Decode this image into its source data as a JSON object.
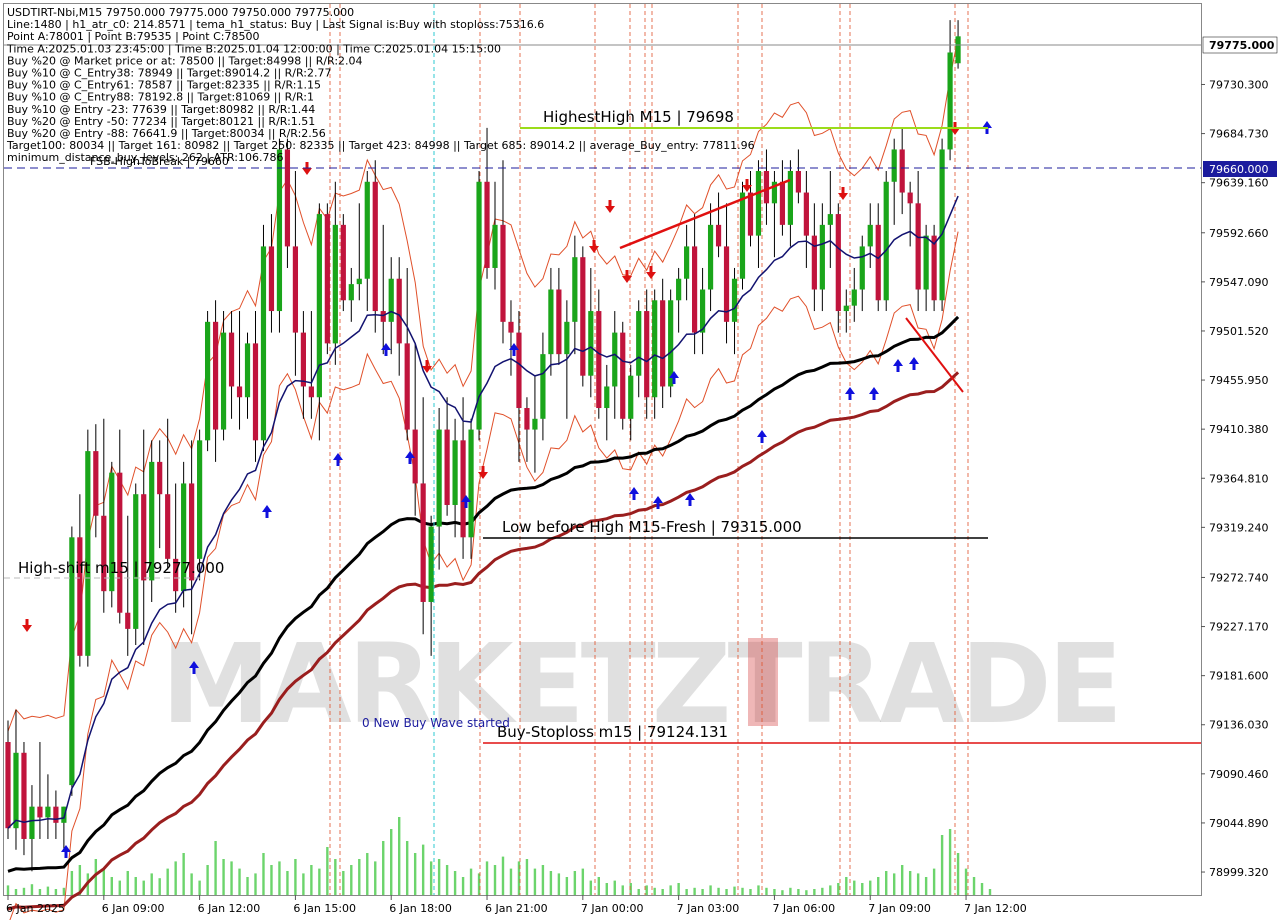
{
  "info_lines": [
    "USDTIRT-Nbi,M15  79750.000 79775.000 79750.000 79775.000",
    "Line:1480 | h1_atr_c0: 214.8571 | tema_h1_status: Buy | Last Signal is:Buy with stoploss:75316.6",
    "Point A:78001 | Point B:79535 | Point C:78500",
    "Time A:2025.01.03 23:45:00 | Time B:2025.01.04 12:00:00 | Time C:2025.01.04 15:15:00",
    "Buy %20 @ Market price or at: 78500 || Target:84998 || R/R:2.04",
    "Buy %10 @ C_Entry38: 78949 || Target:89014.2 || R/R:2.77",
    "Buy %10 @ C_Entry61: 78587 || Target:82335 || R/R:1.15",
    "Buy %10 @ C_Entry88: 78192.8 || Target:81069 || R/R:1",
    "Buy %10 @ Entry -23: 77639 || Target:80982 || R/R:1.44",
    "Buy %20 @ Entry -50: 77234 || Target:80121 || R/R:1.51",
    "Buy %20 @ Entry -88: 76641.9 || Target:80034 || R/R:2.56",
    "Target100: 80034 || Target 161: 80982 || Target 250: 82335 || Target 423: 84998 || Target 685: 89014.2 || average_Buy_entry: 77811.96",
    "minimum_distance_buy_levels: 262 | ATR:106.786"
  ],
  "watermark": "MARKETZTRADE",
  "annotations": {
    "highest_high": "HighestHigh   M15 | 79698",
    "low_before_high": "Low before High   M15-Fresh | 79315.000",
    "high_shift": "High-shift m15 | 79277.000",
    "buy_stoploss": "Buy-Stoploss m15 | 79124.131",
    "fsb_high_tobreak": "FSB-HighToBreak | 79660",
    "new_buy_wave": "0 New Buy Wave started"
  },
  "price_tags": {
    "current": "79775.000",
    "level": "79660.000"
  },
  "colors": {
    "bull_candle": "#1aa51a",
    "bear_candle": "#c0143c",
    "stoploss_line": "#e01010",
    "highest_high_line": "#9bdc1a",
    "fsb_line": "#1c1c9e",
    "tema_line": "#121270",
    "ma_black": "#000000",
    "ma_brown": "#9a1e1e",
    "envelope": "#e0502a",
    "volume": "#6cd46c",
    "arrow_up": "#1010dd",
    "arrow_down": "#dd1010",
    "price_tag_bg": "#1c1c9e"
  },
  "chart_data": {
    "type": "candlestick",
    "symbol": "USDTIRT-Nbi",
    "timeframe": "M15",
    "y_ticks": [
      "79730.300",
      "79684.730",
      "79639.160",
      "79592.660",
      "79547.090",
      "79501.520",
      "79455.950",
      "79410.380",
      "79364.810",
      "79319.240",
      "79272.740",
      "79227.170",
      "79181.600",
      "79136.030",
      "79090.460",
      "79044.890",
      "78999.320"
    ],
    "y_tick_values": [
      79730.3,
      79684.73,
      79639.16,
      79592.66,
      79547.09,
      79501.52,
      79455.95,
      79410.38,
      79364.81,
      79319.24,
      79272.74,
      79227.17,
      79181.6,
      79136.03,
      79090.46,
      79044.89,
      78999.32
    ],
    "ylim": [
      78978,
      79805
    ],
    "x_ticks": [
      "6 Jan 2025",
      "6 Jan 09:00",
      "6 Jan 12:00",
      "6 Jan 15:00",
      "6 Jan 18:00",
      "6 Jan 21:00",
      "7 Jan 00:00",
      "7 Jan 03:00",
      "7 Jan 06:00",
      "7 Jan 09:00",
      "7 Jan 12:00"
    ],
    "x_tick_bars": [
      0,
      12,
      24,
      36,
      48,
      60,
      72,
      84,
      96,
      108,
      120
    ],
    "bars_total": 124,
    "candles": [
      [
        79120,
        79140,
        79030,
        79040
      ],
      [
        79040,
        79150,
        79020,
        79110
      ],
      [
        79110,
        79120,
        79015,
        79030
      ],
      [
        79030,
        79080,
        79000,
        79060
      ],
      [
        79060,
        79120,
        79030,
        79050
      ],
      [
        79050,
        79090,
        79030,
        79060
      ],
      [
        79060,
        79075,
        79030,
        79045
      ],
      [
        79045,
        79060,
        79020,
        79060
      ],
      [
        79080,
        79320,
        79070,
        79310
      ],
      [
        79310,
        79350,
        79190,
        79200
      ],
      [
        79200,
        79410,
        79190,
        79390
      ],
      [
        79390,
        79415,
        79310,
        79330
      ],
      [
        79330,
        79420,
        79240,
        79260
      ],
      [
        79260,
        79380,
        79245,
        79370
      ],
      [
        79370,
        79410,
        79230,
        79240
      ],
      [
        79240,
        79330,
        79200,
        79225
      ],
      [
        79225,
        79360,
        79210,
        79350
      ],
      [
        79350,
        79410,
        79210,
        79270
      ],
      [
        79270,
        79400,
        79250,
        79380
      ],
      [
        79380,
        79400,
        79300,
        79350
      ],
      [
        79350,
        79420,
        79280,
        79290
      ],
      [
        79290,
        79360,
        79240,
        79260
      ],
      [
        79260,
        79380,
        79245,
        79360
      ],
      [
        79360,
        79400,
        79220,
        79270
      ],
      [
        79290,
        79410,
        79270,
        79400
      ],
      [
        79400,
        79520,
        79390,
        79510
      ],
      [
        79510,
        79530,
        79380,
        79410
      ],
      [
        79410,
        79520,
        79400,
        79500
      ],
      [
        79500,
        79520,
        79420,
        79450
      ],
      [
        79450,
        79520,
        79410,
        79440
      ],
      [
        79440,
        79500,
        79420,
        79490
      ],
      [
        79490,
        79520,
        79380,
        79400
      ],
      [
        79400,
        79600,
        79390,
        79580
      ],
      [
        79580,
        79610,
        79500,
        79520
      ],
      [
        79520,
        79680,
        79500,
        79670
      ],
      [
        79670,
        79680,
        79560,
        79580
      ],
      [
        79580,
        79650,
        79460,
        79500
      ],
      [
        79500,
        79520,
        79420,
        79450
      ],
      [
        79450,
        79520,
        79420,
        79440
      ],
      [
        79440,
        79620,
        79400,
        79610
      ],
      [
        79610,
        79620,
        79480,
        79490
      ],
      [
        79490,
        79640,
        79470,
        79600
      ],
      [
        79600,
        79610,
        79520,
        79530
      ],
      [
        79530,
        79560,
        79510,
        79545
      ],
      [
        79545,
        79620,
        79530,
        79550
      ],
      [
        79550,
        79650,
        79520,
        79640
      ],
      [
        79640,
        79660,
        79500,
        79520
      ],
      [
        79520,
        79600,
        79480,
        79510
      ],
      [
        79510,
        79570,
        79480,
        79550
      ],
      [
        79550,
        79570,
        79460,
        79490
      ],
      [
        79490,
        79560,
        79400,
        79410
      ],
      [
        79410,
        79490,
        79330,
        79360
      ],
      [
        79360,
        79440,
        79220,
        79250
      ],
      [
        79250,
        79330,
        79200,
        79320
      ],
      [
        79320,
        79430,
        79280,
        79410
      ],
      [
        79410,
        79440,
        79330,
        79340
      ],
      [
        79340,
        79420,
        79310,
        79400
      ],
      [
        79400,
        79440,
        79290,
        79310
      ],
      [
        79310,
        79420,
        79290,
        79410
      ],
      [
        79410,
        79650,
        79400,
        79640
      ],
      [
        79640,
        79690,
        79550,
        79560
      ],
      [
        79560,
        79640,
        79540,
        79600
      ],
      [
        79600,
        79660,
        79490,
        79510
      ],
      [
        79510,
        79530,
        79460,
        79500
      ],
      [
        79500,
        79520,
        79380,
        79430
      ],
      [
        79430,
        79440,
        79380,
        79410
      ],
      [
        79410,
        79460,
        79370,
        79420
      ],
      [
        79420,
        79500,
        79400,
        79480
      ],
      [
        79480,
        79560,
        79460,
        79540
      ],
      [
        79540,
        79560,
        79470,
        79480
      ],
      [
        79480,
        79530,
        79420,
        79510
      ],
      [
        79510,
        79590,
        79480,
        79570
      ],
      [
        79570,
        79580,
        79450,
        79460
      ],
      [
        79460,
        79560,
        79440,
        79520
      ],
      [
        79520,
        79540,
        79420,
        79430
      ],
      [
        79430,
        79470,
        79400,
        79450
      ],
      [
        79450,
        79520,
        79420,
        79500
      ],
      [
        79500,
        79510,
        79410,
        79420
      ],
      [
        79420,
        79470,
        79400,
        79460
      ],
      [
        79460,
        79530,
        79440,
        79520
      ],
      [
        79520,
        79540,
        79420,
        79440
      ],
      [
        79440,
        79540,
        79420,
        79530
      ],
      [
        79530,
        79550,
        79430,
        79450
      ],
      [
        79450,
        79540,
        79440,
        79530
      ],
      [
        79530,
        79560,
        79500,
        79550
      ],
      [
        79550,
        79600,
        79530,
        79580
      ],
      [
        79580,
        79610,
        79480,
        79500
      ],
      [
        79500,
        79560,
        79480,
        79540
      ],
      [
        79540,
        79620,
        79520,
        79600
      ],
      [
        79600,
        79630,
        79570,
        79580
      ],
      [
        79580,
        79620,
        79490,
        79510
      ],
      [
        79510,
        79560,
        79480,
        79550
      ],
      [
        79550,
        79640,
        79540,
        79630
      ],
      [
        79630,
        79650,
        79580,
        79590
      ],
      [
        79590,
        79660,
        79560,
        79650
      ],
      [
        79650,
        79670,
        79600,
        79620
      ],
      [
        79620,
        79650,
        79570,
        79640
      ],
      [
        79640,
        79660,
        79590,
        79600
      ],
      [
        79600,
        79660,
        79580,
        79650
      ],
      [
        79650,
        79670,
        79620,
        79630
      ],
      [
        79630,
        79650,
        79560,
        79590
      ],
      [
        79590,
        79620,
        79520,
        79540
      ],
      [
        79540,
        79620,
        79520,
        79600
      ],
      [
        79600,
        79650,
        79560,
        79610
      ],
      [
        79610,
        79620,
        79500,
        79520
      ],
      [
        79520,
        79540,
        79500,
        79525
      ],
      [
        79525,
        79560,
        79510,
        79540
      ],
      [
        79540,
        79590,
        79520,
        79580
      ],
      [
        79580,
        79620,
        79560,
        79600
      ],
      [
        79600,
        79620,
        79520,
        79530
      ],
      [
        79530,
        79650,
        79520,
        79640
      ],
      [
        79640,
        79680,
        79600,
        79670
      ],
      [
        79670,
        79690,
        79610,
        79630
      ],
      [
        79630,
        79640,
        79580,
        79620
      ],
      [
        79620,
        79650,
        79520,
        79540
      ],
      [
        79540,
        79600,
        79520,
        79590
      ],
      [
        79590,
        79600,
        79520,
        79530
      ],
      [
        79530,
        79680,
        79520,
        79670
      ],
      [
        79670,
        79790,
        79660,
        79760
      ],
      [
        79750,
        79790,
        79745,
        79775
      ]
    ],
    "volume": [
      0.08,
      0.05,
      0.06,
      0.09,
      0.05,
      0.07,
      0.05,
      0.06,
      0.2,
      0.25,
      0.18,
      0.3,
      0.22,
      0.15,
      0.12,
      0.2,
      0.15,
      0.12,
      0.18,
      0.14,
      0.22,
      0.28,
      0.35,
      0.18,
      0.12,
      0.25,
      0.45,
      0.3,
      0.28,
      0.22,
      0.15,
      0.18,
      0.35,
      0.25,
      0.28,
      0.2,
      0.3,
      0.18,
      0.25,
      0.22,
      0.4,
      0.3,
      0.2,
      0.25,
      0.3,
      0.35,
      0.28,
      0.45,
      0.55,
      0.65,
      0.45,
      0.35,
      0.42,
      0.28,
      0.3,
      0.25,
      0.2,
      0.15,
      0.22,
      0.18,
      0.28,
      0.25,
      0.32,
      0.22,
      0.28,
      0.3,
      0.22,
      0.25,
      0.2,
      0.18,
      0.15,
      0.2,
      0.22,
      0.12,
      0.15,
      0.1,
      0.12,
      0.08,
      0.1,
      0.05,
      0.08,
      0.06,
      0.05,
      0.08,
      0.1,
      0.05,
      0.06,
      0.05,
      0.08,
      0.06,
      0.05,
      0.07,
      0.06,
      0.05,
      0.08,
      0.06,
      0.05,
      0.04,
      0.06,
      0.05,
      0.04,
      0.05,
      0.06,
      0.08,
      0.1,
      0.15,
      0.12,
      0.1,
      0.12,
      0.15,
      0.2,
      0.18,
      0.25,
      0.2,
      0.18,
      0.15,
      0.22,
      0.5,
      0.55,
      0.35,
      0.22,
      0.15,
      0.1,
      0.05
    ]
  }
}
